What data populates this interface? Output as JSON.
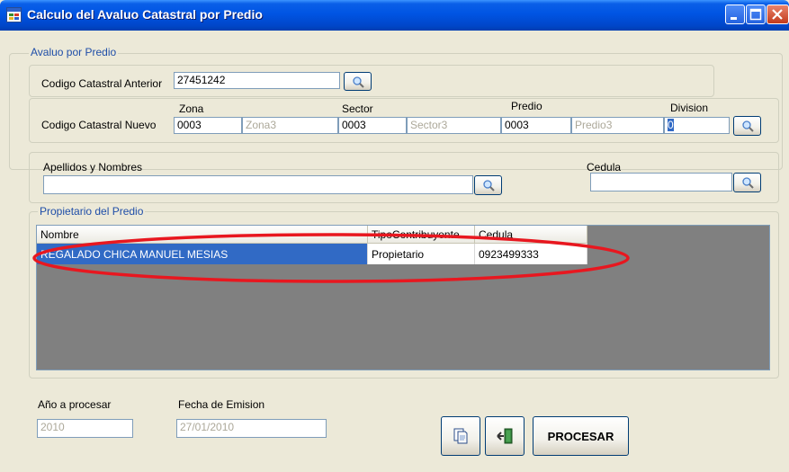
{
  "window": {
    "title": "Calculo del Avaluo Catastral por Predio"
  },
  "avaluo_group": {
    "legend": "Avaluo por Predio",
    "codigo_anterior_label": "Codigo Catastral Anterior",
    "codigo_anterior_value": "27451242",
    "codigo_nuevo_label": "Codigo Catastral Nuevo",
    "zona_label": "Zona",
    "zona_value": "0003",
    "zona_name": "Zona3",
    "sector_label": "Sector",
    "sector_value": "0003",
    "sector_name": "Sector3",
    "predio_label": "Predio",
    "predio_value": "0003",
    "predio_name": "Predio3",
    "division_label": "Division",
    "division_value": "0"
  },
  "owner_search": {
    "apellidos_label": "Apellidos y Nombres",
    "apellidos_value": "",
    "cedula_label": "Cedula",
    "cedula_value": ""
  },
  "propietario_group": {
    "legend": "Propietario del Predio",
    "columns": [
      "Nombre",
      "TipoContribuyente",
      "Cedula"
    ],
    "rows": [
      [
        "REGALADO CHICA MANUEL MESIAS",
        "Propietario",
        "0923499333"
      ]
    ]
  },
  "footer": {
    "anio_label": "Año a procesar",
    "anio_value": "2010",
    "fecha_label": "Fecha de Emision",
    "fecha_value": "27/01/2010",
    "procesar_label": "PROCESAR"
  },
  "icons": {
    "search": "search-icon",
    "document": "document-icon",
    "exit": "exit-door-icon",
    "minimize": "minimize-icon",
    "maximize": "maximize-icon",
    "close": "close-icon"
  },
  "colors": {
    "title_bar": "#0054E3",
    "selected_row": "#316AC5",
    "annotation_ellipse": "#E8171F"
  }
}
